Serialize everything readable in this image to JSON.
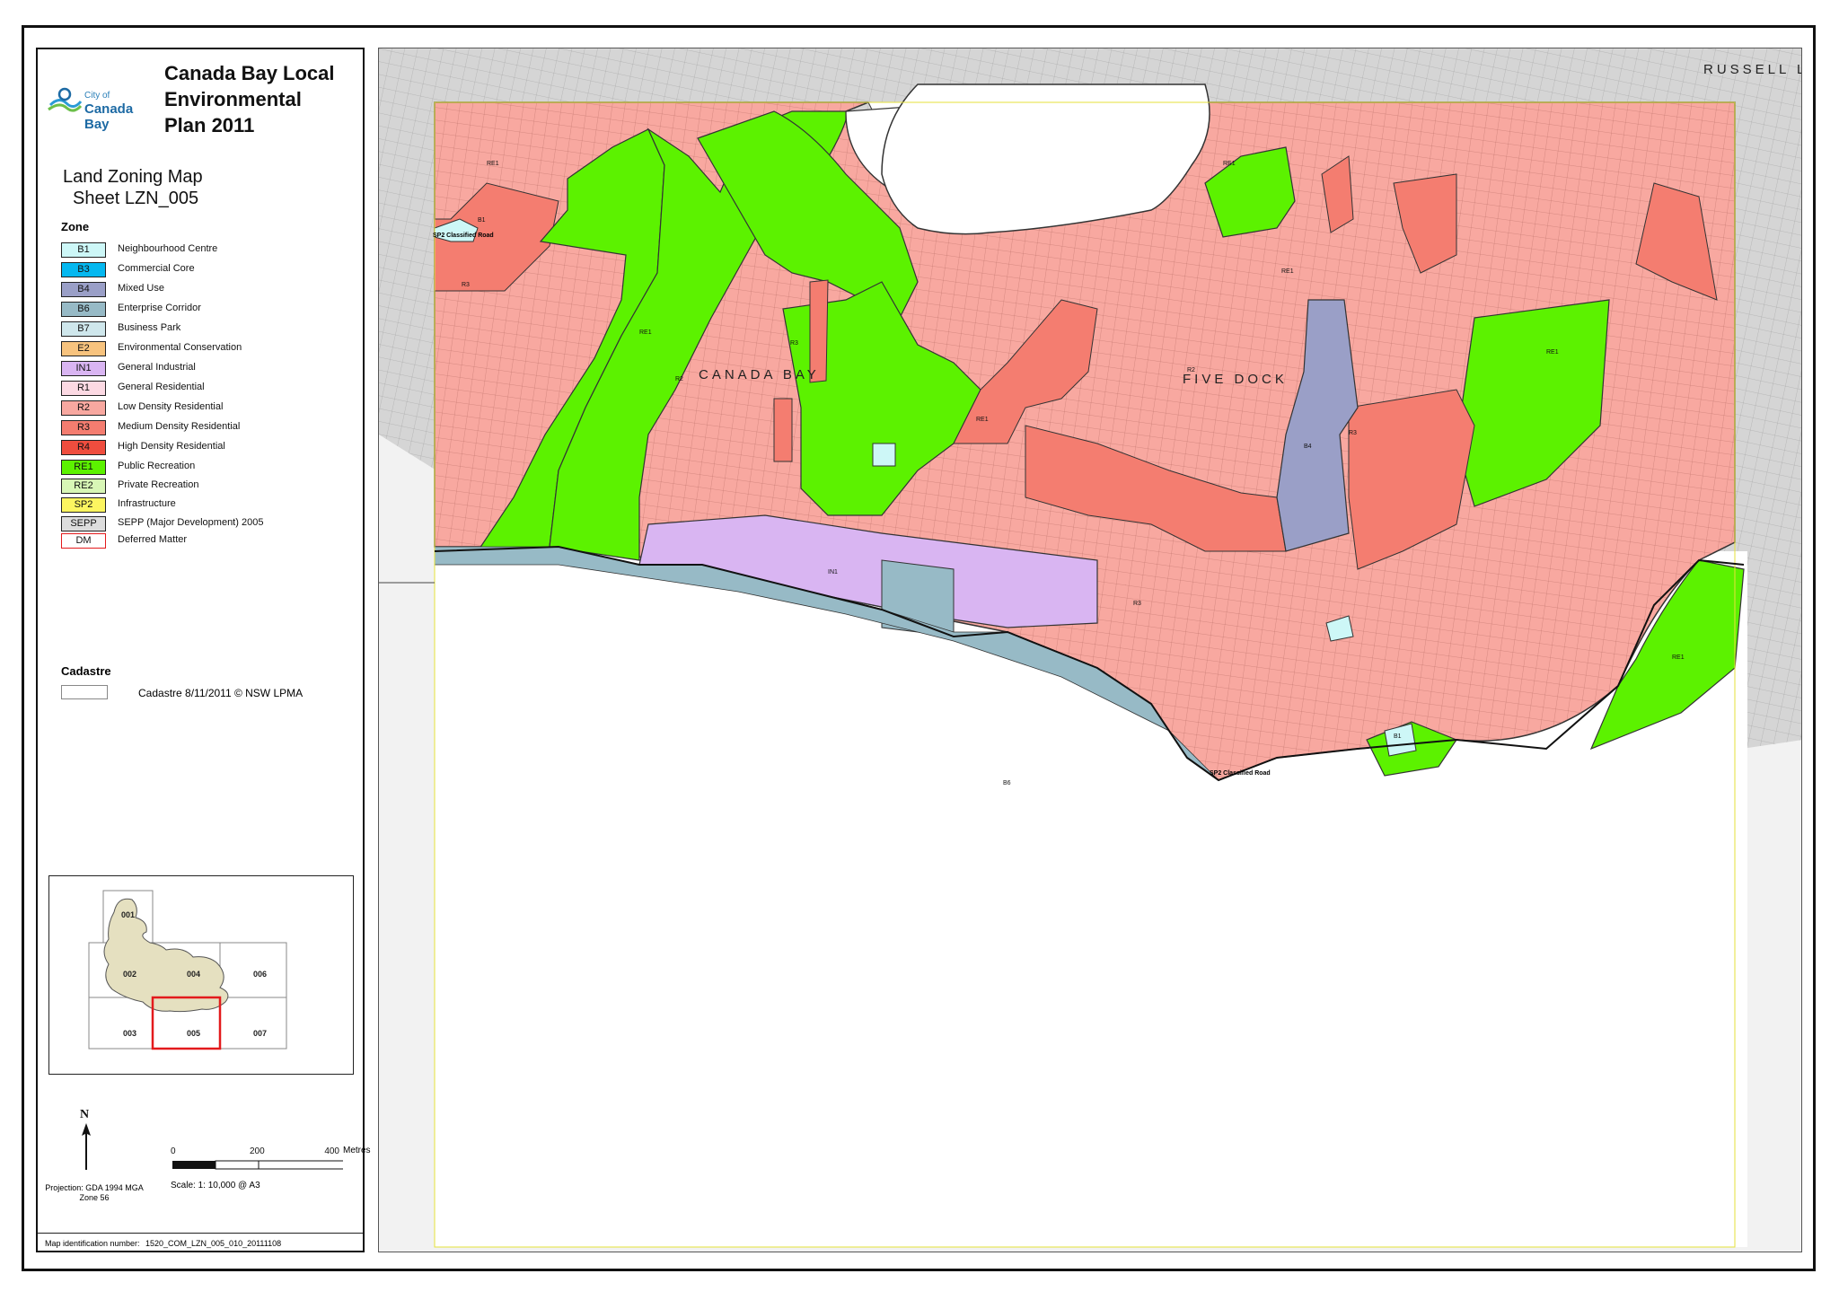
{
  "header": {
    "logo_line1": "City of",
    "logo_line2": "Canada Bay",
    "title_lines": [
      "Canada Bay Local",
      "Environmental",
      "Plan 2011"
    ],
    "map_type": "Land Zoning Map",
    "sheet": "Sheet LZN_005"
  },
  "legend": {
    "heading": "Zone",
    "items": [
      {
        "code": "B1",
        "label": "Neighbourhood Centre",
        "color": "#cdf7f7"
      },
      {
        "code": "B3",
        "label": "Commercial Core",
        "color": "#05b8f0"
      },
      {
        "code": "B4",
        "label": "Mixed Use",
        "color": "#9a9fc7"
      },
      {
        "code": "B6",
        "label": "Enterprise Corridor",
        "color": "#97bac6"
      },
      {
        "code": "B7",
        "label": "Business Park",
        "color": "#cfe7ec"
      },
      {
        "code": "E2",
        "label": "Environmental Conservation",
        "color": "#f7c37e"
      },
      {
        "code": "IN1",
        "label": "General Industrial",
        "color": "#d9b5f2"
      },
      {
        "code": "R1",
        "label": "General Residential",
        "color": "#fcd9e3"
      },
      {
        "code": "R2",
        "label": "Low Density Residential",
        "color": "#f8a8a0"
      },
      {
        "code": "R3",
        "label": "Medium Density Residential",
        "color": "#f47d70"
      },
      {
        "code": "R4",
        "label": "High Density Residential",
        "color": "#ef4d3e"
      },
      {
        "code": "RE1",
        "label": "Public Recreation",
        "color": "#5cf200"
      },
      {
        "code": "RE2",
        "label": "Private Recreation",
        "color": "#d8f7b6"
      },
      {
        "code": "SP2",
        "label": "Infrastructure",
        "color": "#fcf560"
      },
      {
        "code": "SEPP",
        "label": "SEPP (Major Development) 2005",
        "color": "#dddddd"
      },
      {
        "code": "DM",
        "label": "Deferred Matter",
        "color": "#ffffff",
        "border": "#e31a1c"
      }
    ]
  },
  "cadastre": {
    "heading": "Cadastre",
    "label": "Cadastre 8/11/2011 © NSW LPMA"
  },
  "inset_map": {
    "sheets": [
      "001",
      "002",
      "003",
      "004",
      "005",
      "006",
      "007"
    ],
    "current_sheet": "005"
  },
  "scalebar": {
    "north_label": "N",
    "ticks": [
      "0",
      "200",
      "400"
    ],
    "unit": "Metres",
    "projection": "Projection: GDA 1994 MGA Zone 56",
    "scale_text": "Scale: 1: 10,000 @ A3"
  },
  "map_id": {
    "label": "Map identification number:",
    "value": "1520_COM_LZN_005_010_20111108"
  },
  "map": {
    "place_labels": [
      "CANADA BAY",
      "FIVE DOCK",
      "RUSSELL L"
    ],
    "zone_labels": [
      "RE1",
      "RE1",
      "RE1",
      "RE1",
      "RE1",
      "RE1",
      "RE1",
      "R3",
      "R3",
      "R3",
      "R3",
      "B4",
      "B6",
      "IN1",
      "B1",
      "B1",
      "R2",
      "R2"
    ],
    "road_labels": [
      "SP2 Classified Road",
      "SP2 Classified Road"
    ],
    "colors": {
      "R2": "#f8a8a0",
      "R3": "#f47d70",
      "RE1": "#5cf200",
      "B4": "#9a9fc7",
      "B6": "#97bac6",
      "IN1": "#d9b5f2",
      "B1": "#cdf7f7",
      "outside": "#d5d5d5",
      "water": "#ffffff"
    }
  }
}
